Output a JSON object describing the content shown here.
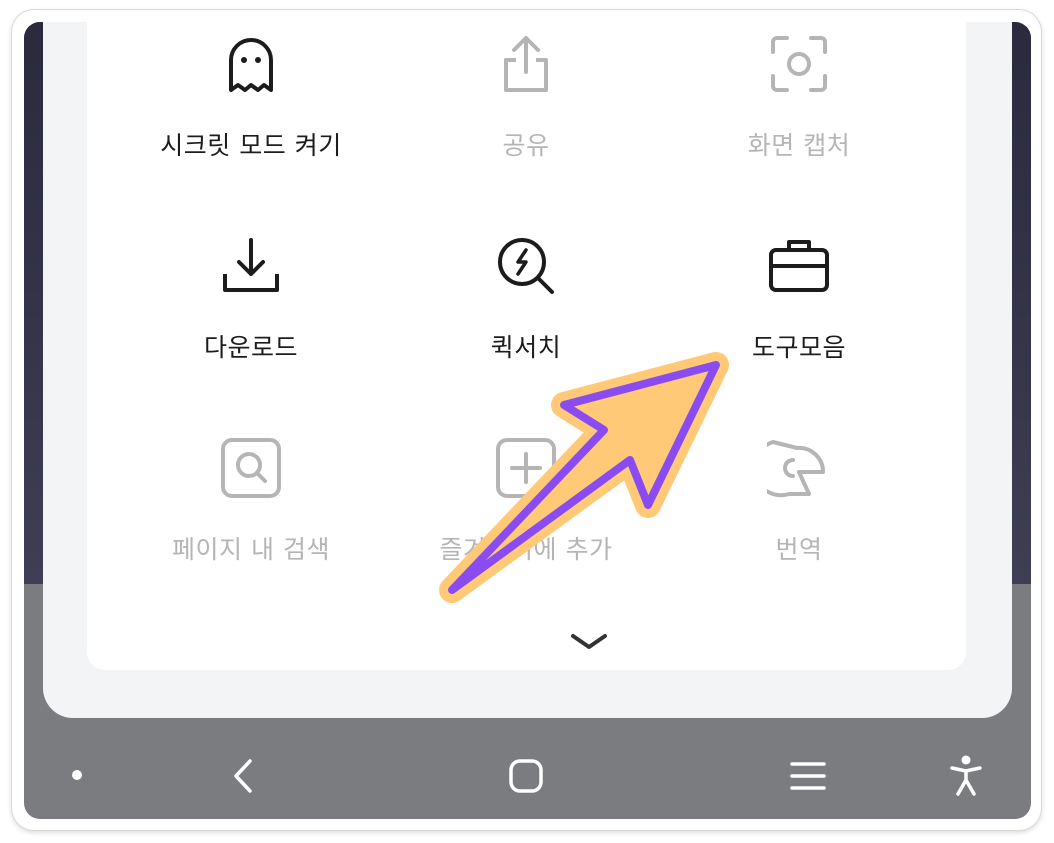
{
  "menu": {
    "items": [
      {
        "label": "시크릿 모드 켜기",
        "icon": "ghost-icon",
        "enabled": true
      },
      {
        "label": "공유",
        "icon": "share-icon",
        "enabled": false
      },
      {
        "label": "화면 캡처",
        "icon": "screen-capture-icon",
        "enabled": false
      },
      {
        "label": "다운로드",
        "icon": "download-icon",
        "enabled": true
      },
      {
        "label": "퀵서치",
        "icon": "quick-search-icon",
        "enabled": true
      },
      {
        "label": "도구모음",
        "icon": "toolbox-icon",
        "enabled": true
      },
      {
        "label": "페이지 내 검색",
        "icon": "find-in-page-icon",
        "enabled": false
      },
      {
        "label": "즐겨찾기에 추가",
        "icon": "add-bookmark-icon",
        "enabled": false
      },
      {
        "label": "번역",
        "icon": "translate-icon",
        "enabled": false
      }
    ],
    "expand_icon": "chevron-down-icon"
  },
  "annotation": {
    "icon": "pointer-arrow-icon",
    "fill": "#ffc978",
    "stroke": "#8a4cf0"
  },
  "navbar": {
    "buttons": [
      "dot-icon",
      "back-icon",
      "home-icon",
      "recent-apps-icon",
      "accessibility-icon"
    ]
  },
  "colors": {
    "icon_active": "#1c1c1c",
    "icon_disabled": "#b5b5b5",
    "navbar": "#7b7c7f",
    "sheet": "#f3f4f6"
  }
}
